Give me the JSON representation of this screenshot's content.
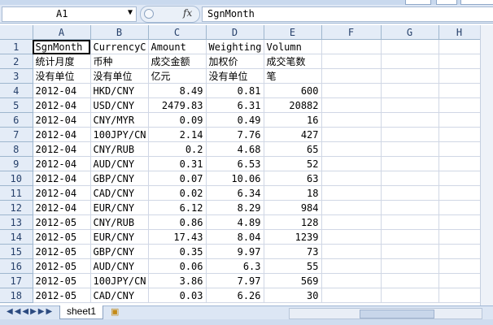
{
  "formula_bar": {
    "cell_ref": "A1",
    "fx": "fx",
    "content": "SgnMonth"
  },
  "columns": [
    "A",
    "B",
    "C",
    "D",
    "E",
    "F",
    "G",
    "H"
  ],
  "header_rows": [
    {
      "num": "1",
      "cells": [
        "SgnMonth",
        "CurrencyC",
        "Amount",
        "Weighting",
        "Volumn"
      ]
    },
    {
      "num": "2",
      "cells": [
        "统计月度",
        "币种",
        "成交金额",
        "加权价",
        "成交笔数"
      ]
    },
    {
      "num": "3",
      "cells": [
        "没有单位",
        "没有单位",
        "亿元",
        "没有单位",
        "笔"
      ]
    }
  ],
  "data_rows": [
    {
      "num": "4",
      "month": "2012-04",
      "pair": "HKD/CNY",
      "amount": "8.49",
      "weighting": "0.81",
      "volume": "600"
    },
    {
      "num": "5",
      "month": "2012-04",
      "pair": "USD/CNY",
      "amount": "2479.83",
      "weighting": "6.31",
      "volume": "20882"
    },
    {
      "num": "6",
      "month": "2012-04",
      "pair": "CNY/MYR",
      "amount": "0.09",
      "weighting": "0.49",
      "volume": "16"
    },
    {
      "num": "7",
      "month": "2012-04",
      "pair": "100JPY/CN",
      "amount": "2.14",
      "weighting": "7.76",
      "volume": "427"
    },
    {
      "num": "8",
      "month": "2012-04",
      "pair": "CNY/RUB",
      "amount": "0.2",
      "weighting": "4.68",
      "volume": "65"
    },
    {
      "num": "9",
      "month": "2012-04",
      "pair": "AUD/CNY",
      "amount": "0.31",
      "weighting": "6.53",
      "volume": "52"
    },
    {
      "num": "10",
      "month": "2012-04",
      "pair": "GBP/CNY",
      "amount": "0.07",
      "weighting": "10.06",
      "volume": "63"
    },
    {
      "num": "11",
      "month": "2012-04",
      "pair": "CAD/CNY",
      "amount": "0.02",
      "weighting": "6.34",
      "volume": "18"
    },
    {
      "num": "12",
      "month": "2012-04",
      "pair": "EUR/CNY",
      "amount": "6.12",
      "weighting": "8.29",
      "volume": "984"
    },
    {
      "num": "13",
      "month": "2012-05",
      "pair": "CNY/RUB",
      "amount": "0.86",
      "weighting": "4.89",
      "volume": "128"
    },
    {
      "num": "14",
      "month": "2012-05",
      "pair": "EUR/CNY",
      "amount": "17.43",
      "weighting": "8.04",
      "volume": "1239"
    },
    {
      "num": "15",
      "month": "2012-05",
      "pair": "GBP/CNY",
      "amount": "0.35",
      "weighting": "9.97",
      "volume": "73"
    },
    {
      "num": "16",
      "month": "2012-05",
      "pair": "AUD/CNY",
      "amount": "0.06",
      "weighting": "6.3",
      "volume": "55"
    },
    {
      "num": "17",
      "month": "2012-05",
      "pair": "100JPY/CN",
      "amount": "3.86",
      "weighting": "7.97",
      "volume": "569"
    },
    {
      "num": "18",
      "month": "2012-05",
      "pair": "CAD/CNY",
      "amount": "0.03",
      "weighting": "6.26",
      "volume": "30"
    }
  ],
  "sheet_tab": "sheet1"
}
